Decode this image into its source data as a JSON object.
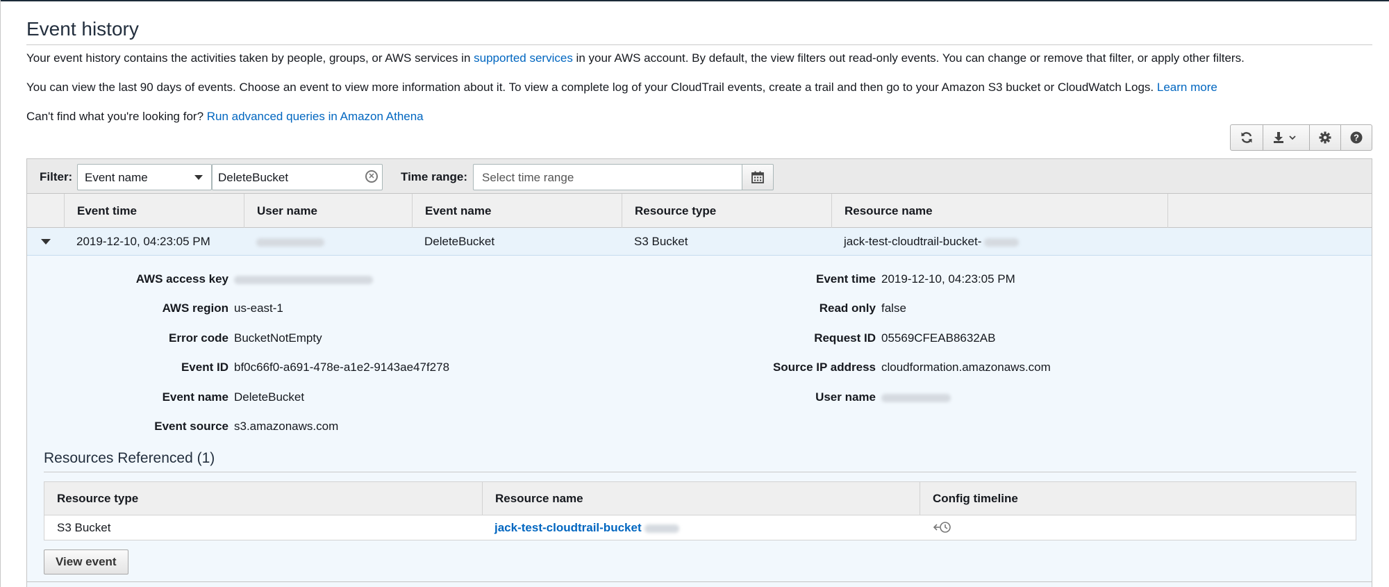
{
  "page": {
    "title": "Event history",
    "intro": {
      "text_before": "Your event history contains the activities taken by people, groups, or AWS services in ",
      "link": "supported services",
      "text_after": " in your AWS account. By default, the view filters out read-only events. You can change or remove that filter, or apply other filters."
    },
    "info": {
      "text": "You can view the last 90 days of events. Choose an event to view more information about it. To view a complete log of your CloudTrail events, create a trail and then go to your Amazon S3 bucket or CloudWatch Logs. ",
      "link": "Learn more"
    },
    "help": {
      "text": "Can't find what you're looking for? ",
      "link": "Run advanced queries in Amazon Athena"
    }
  },
  "toolbar": {
    "icons": [
      "refresh-icon",
      "download-icon",
      "settings-icon",
      "help-icon"
    ]
  },
  "filter": {
    "label": "Filter:",
    "attribute": "Event name",
    "value": "DeleteBucket",
    "time_label": "Time range:",
    "time_placeholder": "Select time range"
  },
  "table": {
    "columns": [
      "Event time",
      "User name",
      "Event name",
      "Resource type",
      "Resource name"
    ],
    "rows": [
      {
        "event_time": "2019-12-10, 04:23:05 PM",
        "event_name": "DeleteBucket",
        "resource_type": "S3 Bucket",
        "resource_name": "jack-test-cloudtrail-bucket-"
      }
    ]
  },
  "detail": {
    "left": [
      {
        "key": "AWS access key",
        "value": ""
      },
      {
        "key": "AWS region",
        "value": "us-east-1"
      },
      {
        "key": "Error code",
        "value": "BucketNotEmpty"
      },
      {
        "key": "Event ID",
        "value": "bf0c66f0-a691-478e-a1e2-9143ae47f278"
      },
      {
        "key": "Event name",
        "value": "DeleteBucket"
      },
      {
        "key": "Event source",
        "value": "s3.amazonaws.com"
      }
    ],
    "right": [
      {
        "key": "Event time",
        "value": "2019-12-10, 04:23:05 PM"
      },
      {
        "key": "Read only",
        "value": "false"
      },
      {
        "key": "Request ID",
        "value": "05569CFEAB8632AB"
      },
      {
        "key": "Source IP address",
        "value": "cloudformation.amazonaws.com"
      },
      {
        "key": "User name",
        "value": ""
      }
    ]
  },
  "resources": {
    "title": "Resources Referenced (1)",
    "columns": [
      "Resource type",
      "Resource name",
      "Config timeline"
    ],
    "rows": [
      {
        "type": "S3 Bucket",
        "name": "jack-test-cloudtrail-bucket"
      }
    ],
    "view_button": "View event"
  },
  "colors": {
    "link": "#0066c0",
    "panel_bg": "#f2f8fd",
    "selected_row": "#e9f3fb"
  }
}
